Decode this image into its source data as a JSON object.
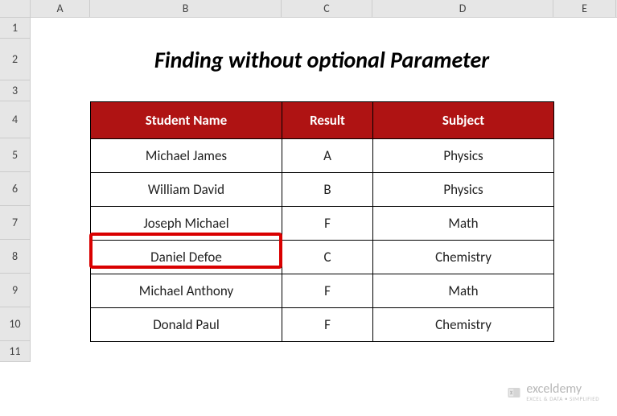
{
  "columns": [
    "A",
    "B",
    "C",
    "D",
    "E"
  ],
  "rows": [
    "1",
    "2",
    "3",
    "4",
    "5",
    "6",
    "7",
    "8",
    "9",
    "10",
    "11"
  ],
  "title": "Finding without optional Parameter",
  "headers": {
    "name": "Student Name",
    "result": "Result",
    "subject": "Subject"
  },
  "data": [
    {
      "name": "Michael James",
      "result": "A",
      "subject": "Physics"
    },
    {
      "name": "William David",
      "result": "B",
      "subject": "Physics"
    },
    {
      "name": "Joseph Michael",
      "result": "F",
      "subject": "Math"
    },
    {
      "name": "Daniel Defoe",
      "result": "C",
      "subject": "Chemistry"
    },
    {
      "name": "Michael Anthony",
      "result": "F",
      "subject": "Math"
    },
    {
      "name": "Donald Paul",
      "result": "F",
      "subject": "Chemistry"
    }
  ],
  "watermark": {
    "main": "exceldemy",
    "sub": "EXCEL & DATA • SIMPLIFIED"
  }
}
